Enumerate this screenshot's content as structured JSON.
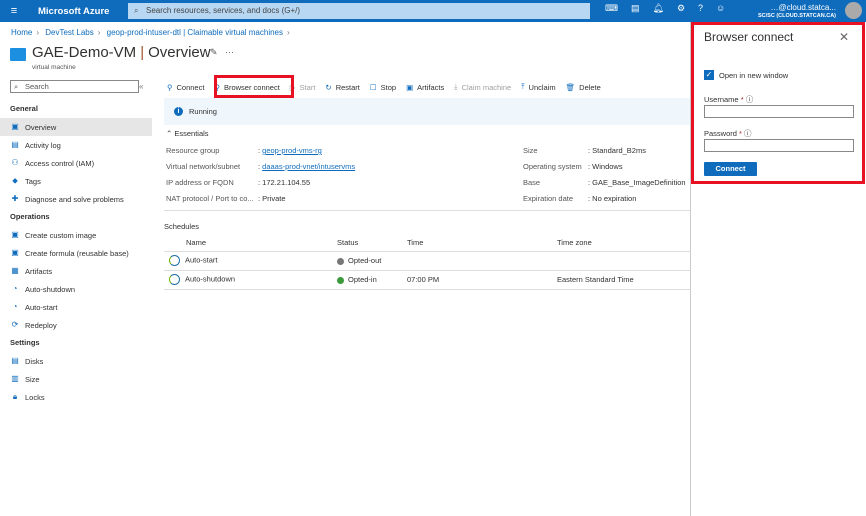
{
  "topbar": {
    "brand": "Microsoft Azure",
    "search_placeholder": "Search resources, services, and docs (G+/)",
    "account": "…@cloud.statca...",
    "directory": "SC/SC (CLOUD.STATCAN.CA)"
  },
  "breadcrumb": [
    "Home",
    "DevTest Labs",
    "geop-prod-intuser-dtl | Claimable virtual machines"
  ],
  "header": {
    "name": "GAE-Demo-VM",
    "section": "Overview",
    "subtitle": "virtual machine"
  },
  "sidebar": {
    "search_placeholder": "Search",
    "sections": [
      {
        "title": "General",
        "items": [
          "Overview",
          "Activity log",
          "Access control (IAM)",
          "Tags",
          "Diagnose and solve problems"
        ]
      },
      {
        "title": "Operations",
        "items": [
          "Create custom image",
          "Create formula (reusable base)",
          "Artifacts",
          "Auto-shutdown",
          "Auto-start",
          "Redeploy"
        ]
      },
      {
        "title": "Settings",
        "items": [
          "Disks",
          "Size",
          "Locks"
        ]
      }
    ]
  },
  "toolbar": [
    "Connect",
    "Browser connect",
    "Start",
    "Restart",
    "Stop",
    "Artifacts",
    "Claim machine",
    "Unclaim",
    "Delete"
  ],
  "status": "Running",
  "essentials": {
    "title": "Essentials",
    "left": [
      [
        "Resource group",
        "geop-prod-vms-rg"
      ],
      [
        "Virtual network/subnet",
        "daaas-prod-vnet/intuservms"
      ],
      [
        "IP address or FQDN",
        "172.21.104.55"
      ],
      [
        "NAT protocol / Port to co...",
        "Private"
      ]
    ],
    "right": [
      [
        "Size",
        "Standard_B2ms"
      ],
      [
        "Operating system",
        "Windows"
      ],
      [
        "Base",
        "GAE_Base_ImageDefinition"
      ],
      [
        "Expiration date",
        "No expiration"
      ]
    ]
  },
  "schedules": {
    "title": "Schedules",
    "columns": [
      "Name",
      "Status",
      "Time",
      "Time zone"
    ],
    "rows": [
      [
        "Auto-start",
        "Opted-out",
        "",
        ""
      ],
      [
        "Auto-shutdown",
        "Opted-in",
        "07:00 PM",
        "Eastern Standard Time"
      ]
    ]
  },
  "panel": {
    "title": "Browser connect",
    "checkbox": "Open in new window",
    "checked": true,
    "username_label": "Username",
    "password_label": "Password",
    "username_value": "",
    "password_value": "",
    "connect": "Connect"
  },
  "colors": {
    "accent": "#0f6cbd",
    "highlight": "#e81123"
  }
}
